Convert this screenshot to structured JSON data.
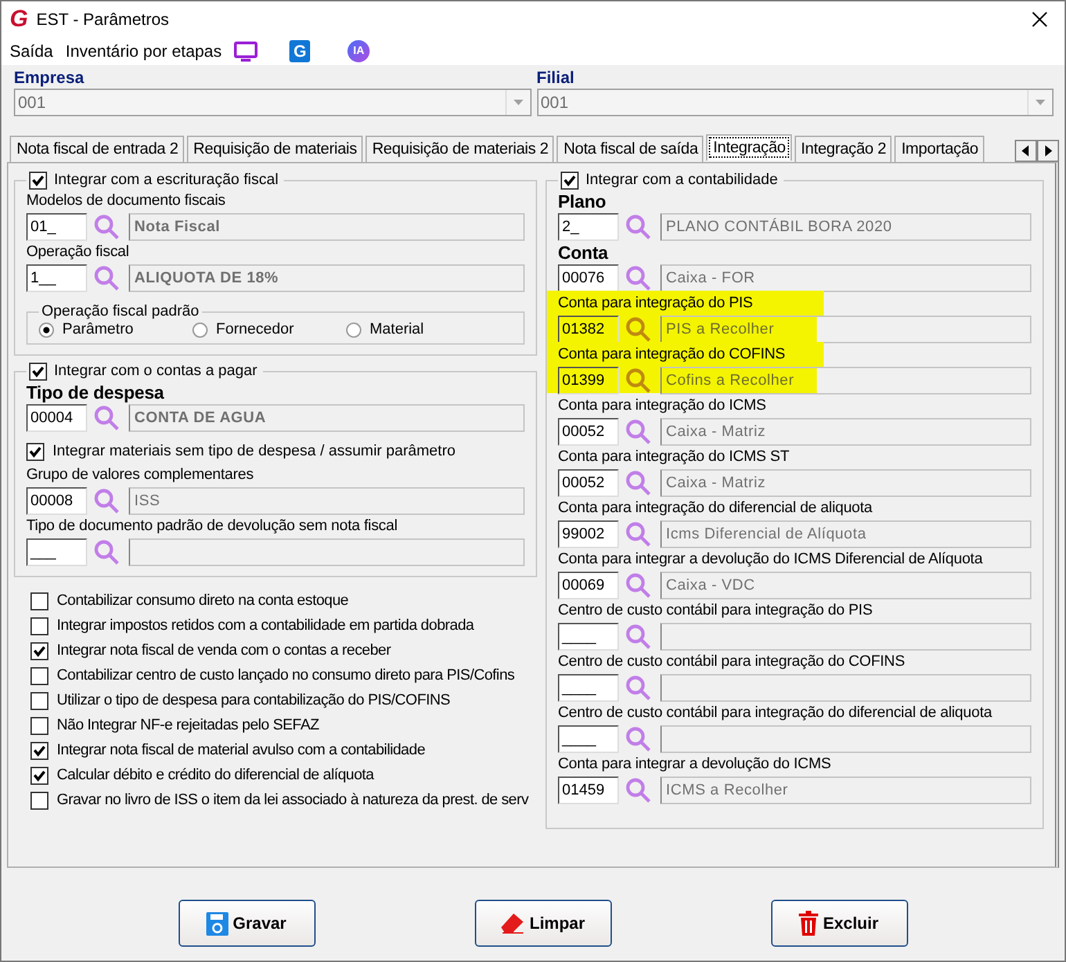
{
  "window": {
    "logo": "G",
    "title": "EST - Parâmetros"
  },
  "menu": [
    {
      "kind": "text",
      "label": "Saída"
    },
    {
      "kind": "text",
      "label": "Inventário por etapas"
    },
    {
      "kind": "monitor"
    },
    {
      "kind": "badge",
      "label": "G"
    },
    {
      "kind": "round",
      "label": "IA"
    }
  ],
  "empresa": {
    "label": "Empresa",
    "value": "001"
  },
  "filial": {
    "label": "Filial",
    "value": "001"
  },
  "tabs": [
    {
      "label": "Nota fiscal de entrada 2",
      "selected": false
    },
    {
      "label": "Requisição de materiais",
      "selected": false
    },
    {
      "label": "Requisição de materiais 2",
      "selected": false
    },
    {
      "label": "Nota fiscal de saída",
      "selected": false
    },
    {
      "label": "Integração",
      "selected": true
    },
    {
      "label": "Integração 2",
      "selected": false
    },
    {
      "label": "Importação",
      "selected": false
    }
  ],
  "fiscal_group": {
    "title": "Integrar com a escrituração fiscal",
    "checked": true,
    "items": [
      {
        "kind": "lookup",
        "label": "Modelos de documento fiscais",
        "label_bold": false,
        "code": "01_",
        "description": "Nota Fiscal",
        "description_bold": true
      },
      {
        "kind": "lookup",
        "label": "Operação fiscal",
        "label_bold": false,
        "code": "1__",
        "description": "ALIQUOTA DE 18%",
        "description_bold": true
      }
    ],
    "radio_group": {
      "title": "Operação fiscal padrão",
      "options": [
        {
          "label": "Parâmetro",
          "selected": true
        },
        {
          "label": "Fornecedor",
          "selected": false
        },
        {
          "label": "Material",
          "selected": false
        }
      ]
    }
  },
  "payables_group": {
    "title": "Integrar com o contas a pagar",
    "checked": true,
    "items": [
      {
        "kind": "lookup",
        "label": "Tipo de despesa",
        "label_bold": true,
        "code": "00004",
        "description": "CONTA DE AGUA",
        "description_bold": true
      },
      {
        "kind": "checkbox",
        "label": "Integrar materiais sem tipo de despesa / assumir parâmetro",
        "checked": true
      },
      {
        "kind": "lookup",
        "label": "Grupo de valores complementares",
        "label_bold": false,
        "code": "00008",
        "description": "ISS",
        "description_bold": false
      },
      {
        "kind": "lookup",
        "label": "Tipo de documento padrão de devolução sem nota fiscal",
        "label_bold": false,
        "code": "___",
        "description_bold": false
      }
    ]
  },
  "options": [
    {
      "label": "Contabilizar consumo direto na conta estoque",
      "checked": false
    },
    {
      "label": "Integrar impostos retidos com a contabilidade em partida dobrada",
      "checked": false
    },
    {
      "label": "Integrar nota fiscal de venda com o contas a receber",
      "checked": true
    },
    {
      "label": "Contabilizar centro de custo lançado no consumo direto para PIS/Cofins",
      "checked": false
    },
    {
      "label": "Utilizar o tipo de despesa para contabilização do PIS/COFINS",
      "checked": false
    },
    {
      "label": "Não Integrar NF-e rejeitadas pelo SEFAZ",
      "checked": false
    },
    {
      "label": "Integrar nota fiscal de material avulso com a contabilidade",
      "checked": true
    },
    {
      "label": "Calcular débito e crédito do diferencial de alíquota",
      "checked": true
    },
    {
      "label": "Gravar no livro de ISS o item da lei associado à natureza da prest. de serv",
      "checked": false
    }
  ],
  "accounting_group": {
    "title": "Integrar com a contabilidade",
    "checked": true,
    "items": [
      {
        "label": "Plano",
        "label_bold": true,
        "code": "2_",
        "description": "PLANO CONTÁBIL BORA 2020",
        "highlighted": false
      },
      {
        "label": "Conta",
        "label_bold": true,
        "code": "00076",
        "description": "Caixa - FOR",
        "highlighted": false
      },
      {
        "label": "Conta para integração do PIS",
        "label_bold": false,
        "code": "01382",
        "description": "PIS a Recolher",
        "highlighted": true
      },
      {
        "label": "Conta para integração do COFINS",
        "label_bold": false,
        "code": "01399",
        "description": "Cofins a Recolher",
        "highlighted": true
      },
      {
        "label": "Conta para integração do ICMS",
        "label_bold": false,
        "code": "00052",
        "description": "Caixa - Matriz",
        "highlighted": false
      },
      {
        "label": "Conta para integração do ICMS ST",
        "label_bold": false,
        "code": "00052",
        "description": "Caixa - Matriz",
        "highlighted": false
      },
      {
        "label": "Conta para integração do diferencial de aliquota",
        "label_bold": false,
        "code": "99002",
        "description": "Icms Diferencial de Alíquota",
        "highlighted": false
      },
      {
        "label": "Conta para integrar a devolução do ICMS Diferencial de Alíquota",
        "label_bold": false,
        "code": "00069",
        "description": "Caixa - VDC",
        "highlighted": false
      },
      {
        "label": "Centro de custo contábil para integração do PIS",
        "label_bold": false,
        "code": "____",
        "highlighted": false
      },
      {
        "label": "Centro de custo contábil para integração do COFINS",
        "label_bold": false,
        "code": "____",
        "highlighted": false
      },
      {
        "label": "Centro de custo contábil para integração do diferencial de aliquota",
        "label_bold": false,
        "code": "____",
        "highlighted": false
      },
      {
        "label": "Conta para integrar a devolução do ICMS",
        "label_bold": false,
        "code": "01459",
        "description": "ICMS a Recolher",
        "highlighted": false
      }
    ]
  },
  "buttons": [
    {
      "kind": "save",
      "label": "Gravar"
    },
    {
      "kind": "clear",
      "label": "Limpar"
    },
    {
      "kind": "delete",
      "label": "Excluir"
    }
  ]
}
